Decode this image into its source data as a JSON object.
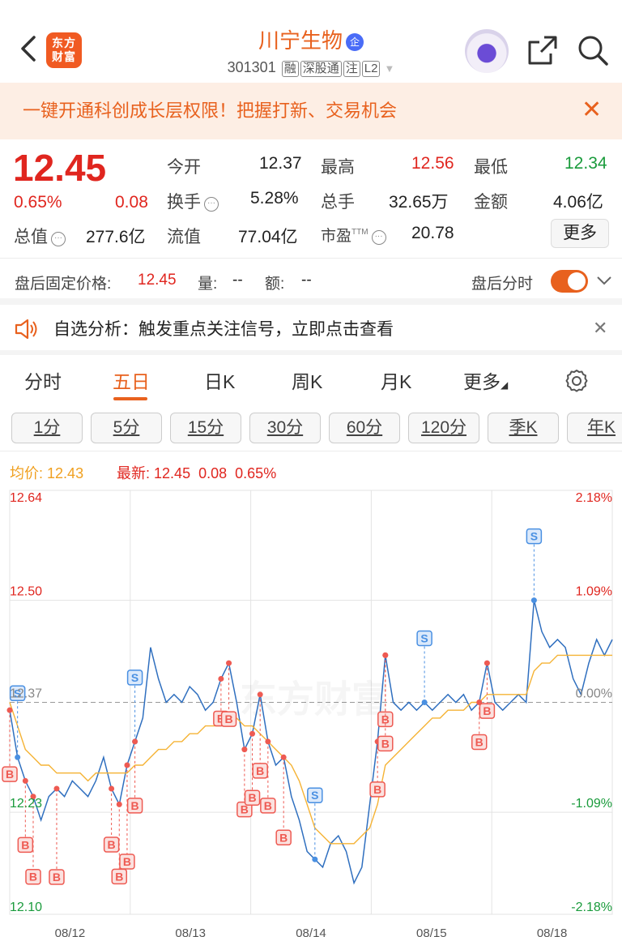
{
  "header": {
    "logo": "东方\n财富",
    "stock_name": "川宁生物",
    "badge": "企",
    "code": "301301",
    "tags": [
      "融",
      "深股通",
      "注",
      "L2"
    ]
  },
  "banner": {
    "text": "一键开通科创成长层权限！把握打新、交易机会"
  },
  "quote": {
    "price": "12.45",
    "change_pct": "0.65%",
    "change": "0.08",
    "open_label": "今开",
    "open": "12.37",
    "high_label": "最高",
    "high": "12.56",
    "low_label": "最低",
    "low": "12.34",
    "turnover_label": "换手",
    "turnover": "5.28%",
    "volume_label": "总手",
    "volume": "32.65万",
    "amount_label": "金额",
    "amount": "4.06亿",
    "mcap_label": "总值",
    "mcap": "277.6亿",
    "float_label": "流值",
    "float": "77.04亿",
    "pe_label": "市盈",
    "pe_sup": "TTM",
    "pe": "20.78",
    "more": "更多"
  },
  "after_hours": {
    "label": "盘后固定价格:",
    "price": "12.45",
    "vol_label": "量:",
    "vol": "--",
    "amt_label": "额:",
    "amt": "--",
    "right_label": "盘后分时"
  },
  "signal": {
    "text": "自选分析：触发重点关注信号，立即点击查看"
  },
  "tabs": [
    "分时",
    "五日",
    "日K",
    "周K",
    "月K",
    "更多"
  ],
  "active_tab": "五日",
  "periods": [
    "1分",
    "5分",
    "15分",
    "30分",
    "60分",
    "120分",
    "季K",
    "年K"
  ],
  "legend": {
    "avg_label": "均价:",
    "avg": "12.43",
    "latest_label": "最新:",
    "latest": "12.45",
    "chg": "0.08",
    "pct": "0.65%"
  },
  "colors": {
    "accent": "#e8611e",
    "up": "#e0261f",
    "down": "#1a9b3c",
    "price_line": "#2f6fbf",
    "avg_line": "#f5b335"
  },
  "chart_data": {
    "type": "line",
    "x": [
      "08/12",
      "08/13",
      "08/14",
      "08/15",
      "08/18"
    ],
    "y_ticks_left": [
      "12.64",
      "12.50",
      "12.37",
      "12.23",
      "12.10"
    ],
    "y_ticks_right": [
      "2.18%",
      "1.09%",
      "0.00%",
      "-1.09%",
      "-2.18%"
    ],
    "ylim": [
      12.1,
      12.64
    ],
    "prev_close": 12.37,
    "series": [
      {
        "values": [
          12.36,
          12.3,
          12.27,
          12.25,
          12.22,
          12.25,
          12.26,
          12.25,
          12.27,
          12.26,
          12.25,
          12.27,
          12.3,
          12.26,
          12.24,
          12.29,
          12.32,
          12.35,
          12.44,
          12.4,
          12.37,
          12.38,
          12.37,
          12.39,
          12.38,
          12.36,
          12.37,
          12.4,
          12.42,
          12.37,
          12.31,
          12.33,
          12.38,
          12.32,
          12.29,
          12.3,
          12.25,
          12.22,
          12.18,
          12.17,
          12.16,
          12.19,
          12.2,
          12.18,
          12.14,
          12.16,
          12.24,
          12.32,
          12.43,
          12.37,
          12.36,
          12.37,
          12.36,
          12.37,
          12.36,
          12.37,
          12.38,
          12.37,
          12.38,
          12.36,
          12.37,
          12.42,
          12.37,
          12.36,
          12.37,
          12.38,
          12.37,
          12.5,
          12.46,
          12.44,
          12.45,
          12.44,
          12.4,
          12.38,
          12.42,
          12.45,
          12.43,
          12.45
        ]
      },
      {
        "values": [
          12.37,
          12.34,
          12.31,
          12.3,
          12.29,
          12.29,
          12.28,
          12.28,
          12.28,
          12.28,
          12.27,
          12.28,
          12.28,
          12.28,
          12.28,
          12.28,
          12.29,
          12.29,
          12.3,
          12.31,
          12.31,
          12.32,
          12.32,
          12.33,
          12.33,
          12.34,
          12.34,
          12.34,
          12.35,
          12.35,
          12.34,
          12.34,
          12.33,
          12.32,
          12.31,
          12.3,
          12.29,
          12.27,
          12.24,
          12.21,
          12.2,
          12.19,
          12.19,
          12.19,
          12.19,
          12.2,
          12.21,
          12.24,
          12.29,
          12.3,
          12.31,
          12.32,
          12.33,
          12.34,
          12.35,
          12.35,
          12.36,
          12.36,
          12.36,
          12.37,
          12.37,
          12.38,
          12.38,
          12.38,
          12.38,
          12.38,
          12.38,
          12.41,
          12.42,
          12.42,
          12.43,
          12.43,
          12.43,
          12.43,
          12.43,
          12.43,
          12.43,
          12.43
        ]
      }
    ],
    "markers": [
      {
        "label": "S",
        "type": "sell"
      },
      {
        "label": "S",
        "type": "sell"
      },
      {
        "label": "S",
        "type": "sell"
      },
      {
        "label": "S",
        "type": "sell"
      },
      {
        "label": "S",
        "type": "sell"
      },
      {
        "label": "B",
        "type": "buy"
      },
      {
        "label": "B",
        "type": "buy"
      },
      {
        "label": "B",
        "type": "buy"
      },
      {
        "label": "B",
        "type": "buy"
      },
      {
        "label": "B",
        "type": "buy"
      },
      {
        "label": "B",
        "type": "buy"
      },
      {
        "label": "B",
        "type": "buy"
      },
      {
        "label": "B",
        "type": "buy"
      },
      {
        "label": "B",
        "type": "buy"
      },
      {
        "label": "B",
        "type": "buy"
      },
      {
        "label": "B",
        "type": "buy"
      },
      {
        "label": "B",
        "type": "buy"
      },
      {
        "label": "B",
        "type": "buy"
      },
      {
        "label": "B",
        "type": "buy"
      },
      {
        "label": "B",
        "type": "buy"
      },
      {
        "label": "B",
        "type": "buy"
      },
      {
        "label": "B",
        "type": "buy"
      },
      {
        "label": "B",
        "type": "buy"
      },
      {
        "label": "B",
        "type": "buy"
      },
      {
        "label": "B",
        "type": "buy"
      }
    ],
    "grid": true,
    "watermark": "东方财富"
  }
}
